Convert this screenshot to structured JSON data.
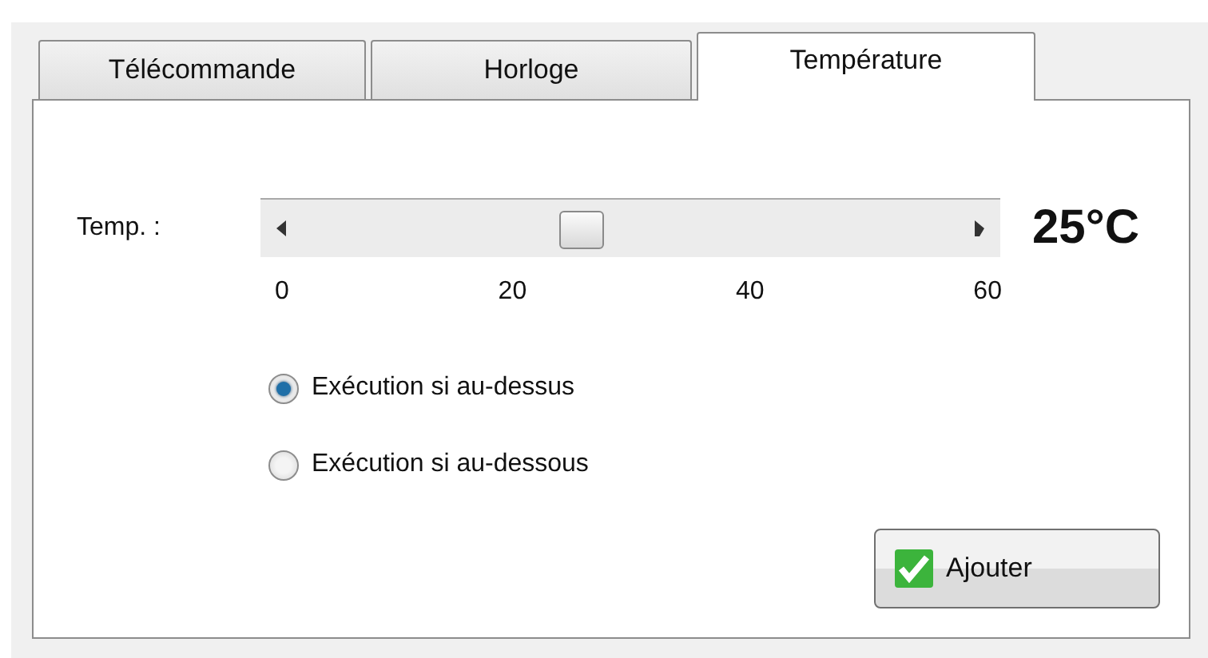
{
  "tabs": [
    {
      "label": "Télécommande",
      "selected": false
    },
    {
      "label": "Horloge",
      "selected": false
    },
    {
      "label": "Température",
      "selected": true
    }
  ],
  "temperature": {
    "label": "Temp. :",
    "level": 0.42,
    "reading": "25°C",
    "ticks": [
      "0",
      "20",
      "40",
      "60"
    ]
  },
  "options": [
    {
      "label": "Exécution si au-dessus",
      "selected": true
    },
    {
      "label": "Exécution si au-dessous",
      "selected": false
    }
  ],
  "button": {
    "label": "Ajouter"
  }
}
